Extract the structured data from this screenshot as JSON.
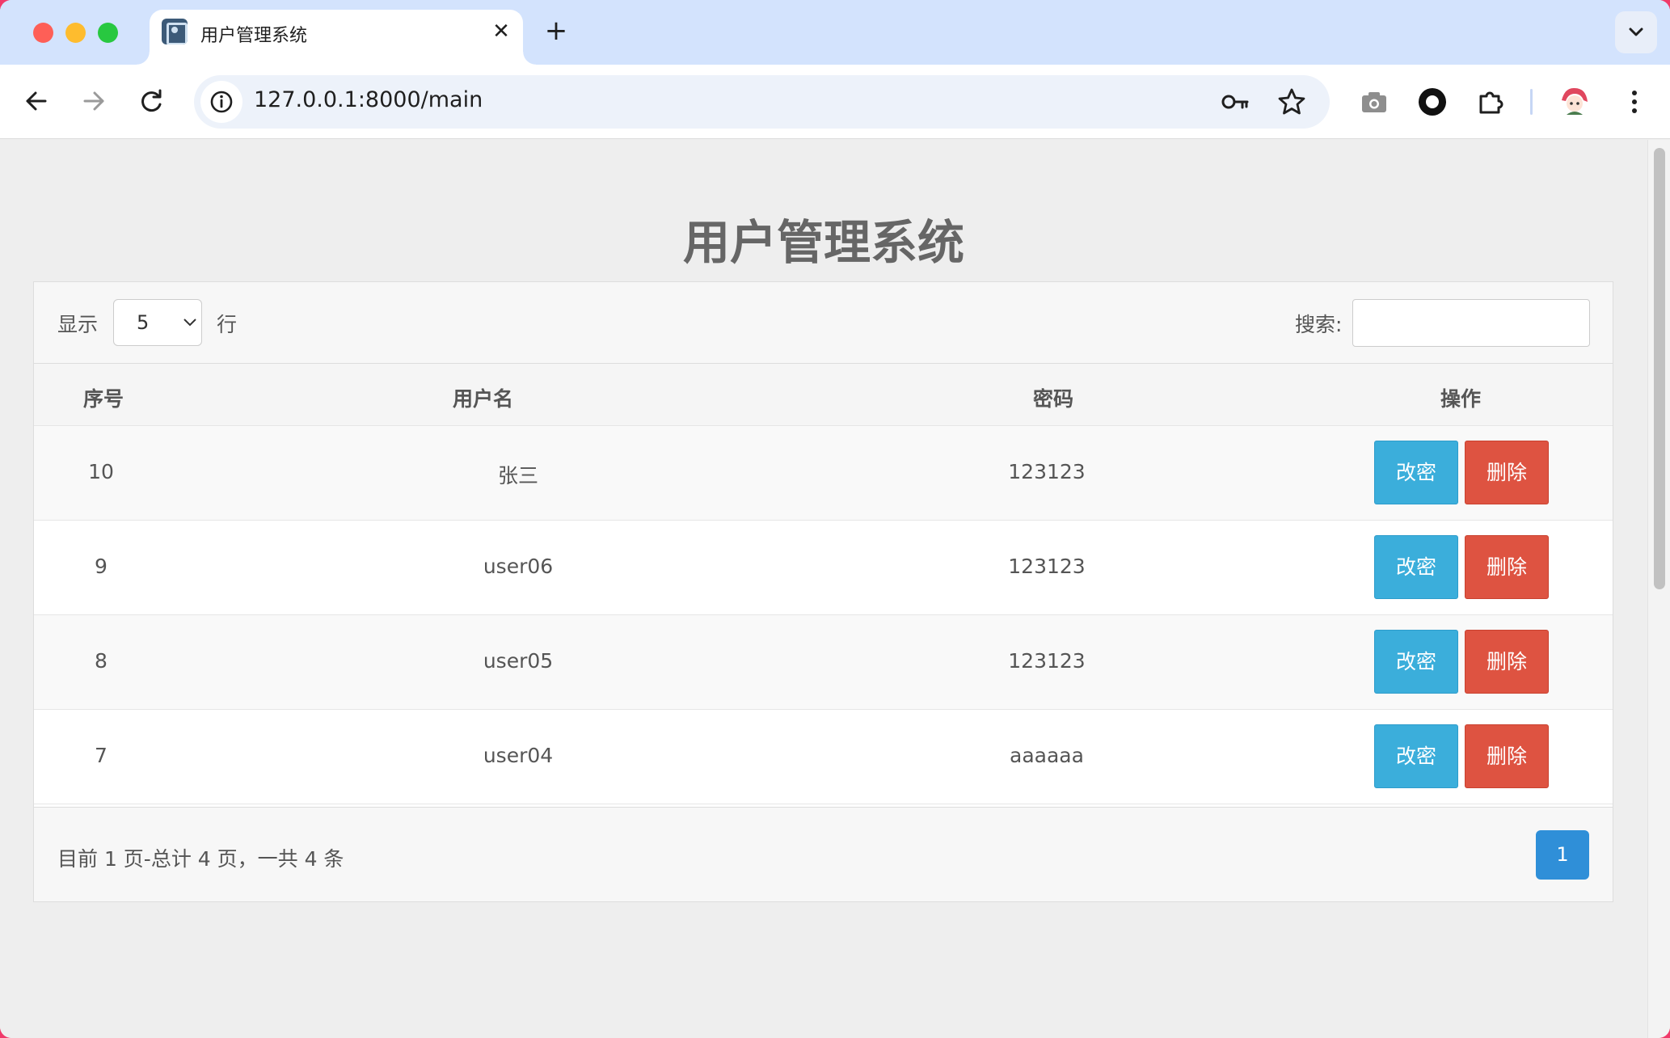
{
  "browser": {
    "tab_title": "用户管理系统",
    "tab_close_glyph": "✕",
    "new_tab_glyph": "+",
    "url": "127.0.0.1:8000/main"
  },
  "page": {
    "title": "用户管理系统"
  },
  "controls": {
    "show_label": "显示",
    "rows_per_page": "5",
    "rows_suffix": "行",
    "search_label": "搜索:",
    "search_value": ""
  },
  "table": {
    "headers": [
      "序号",
      "用户名",
      "密码",
      "操作"
    ],
    "rows": [
      {
        "id": "10",
        "username": "张三",
        "password": "123123",
        "edit": "改密",
        "delete": "删除"
      },
      {
        "id": "9",
        "username": "user06",
        "password": "123123",
        "edit": "改密",
        "delete": "删除"
      },
      {
        "id": "8",
        "username": "user05",
        "password": "123123",
        "edit": "改密",
        "delete": "删除"
      },
      {
        "id": "7",
        "username": "user04",
        "password": "aaaaaa",
        "edit": "改密",
        "delete": "删除"
      }
    ]
  },
  "footer": {
    "page_info": "目前 1 页-总计 4 页，一共 4 条",
    "current_page": "1"
  },
  "colors": {
    "edit_button": "#3baedb",
    "delete_button": "#de5341",
    "pagination_active": "#2f8fd8",
    "tab_strip": "#d3e3fd"
  }
}
